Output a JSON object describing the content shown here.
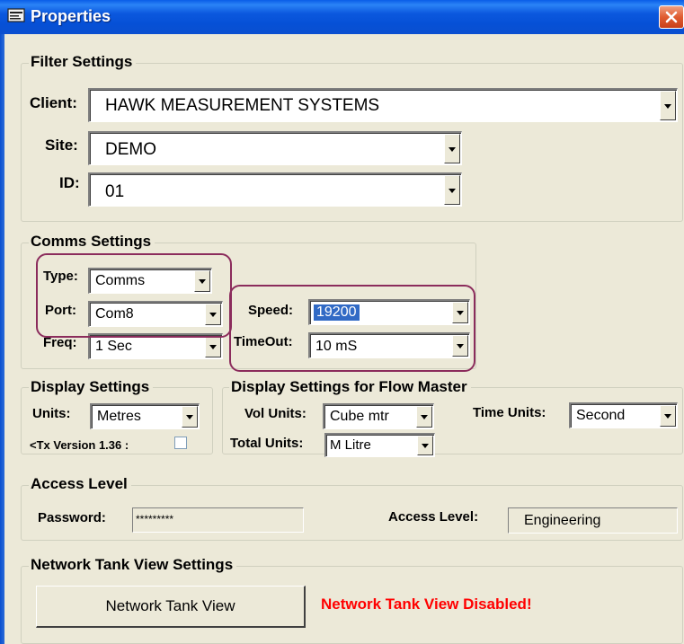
{
  "window": {
    "title": "Properties",
    "icon": "properties-window-icon",
    "close_icon": "close-icon"
  },
  "filter": {
    "legend": "Filter Settings",
    "client_label": "Client:",
    "client_value": "HAWK MEASUREMENT SYSTEMS",
    "site_label": "Site:",
    "site_value": "DEMO",
    "id_label": "ID:",
    "id_value": "01"
  },
  "comms": {
    "legend": "Comms Settings",
    "type_label": "Type:",
    "type_value": "Comms",
    "port_label": "Port:",
    "port_value": "Com8",
    "freq_label": "Freq:",
    "freq_value": "1 Sec",
    "speed_label": "Speed:",
    "speed_value": "19200",
    "timeout_label": "TimeOut:",
    "timeout_value": "10 mS"
  },
  "display": {
    "legend": "Display Settings",
    "units_label": "Units:",
    "units_value": "Metres",
    "tx_label": "<Tx Version 1.36 :",
    "tx_checked": false
  },
  "flow": {
    "legend": "Display Settings for Flow Master",
    "vol_label": "Vol Units:",
    "vol_value": "Cube mtr",
    "time_label": "Time Units:",
    "time_value": "Second",
    "total_label": "Total Units:",
    "total_value": "M Litre"
  },
  "access": {
    "legend": "Access Level",
    "password_label": "Password:",
    "password_value": "*********",
    "level_label": "Access Level:",
    "level_value": "Engineering"
  },
  "network": {
    "legend": "Network Tank View Settings",
    "button_label": "Network Tank View",
    "status": "Network Tank View Disabled!"
  },
  "colors": {
    "highlight_outline": "#8b2c5c",
    "error_text": "#ff0000",
    "selection": "#316ac5",
    "title_bar": "#0a58de"
  }
}
